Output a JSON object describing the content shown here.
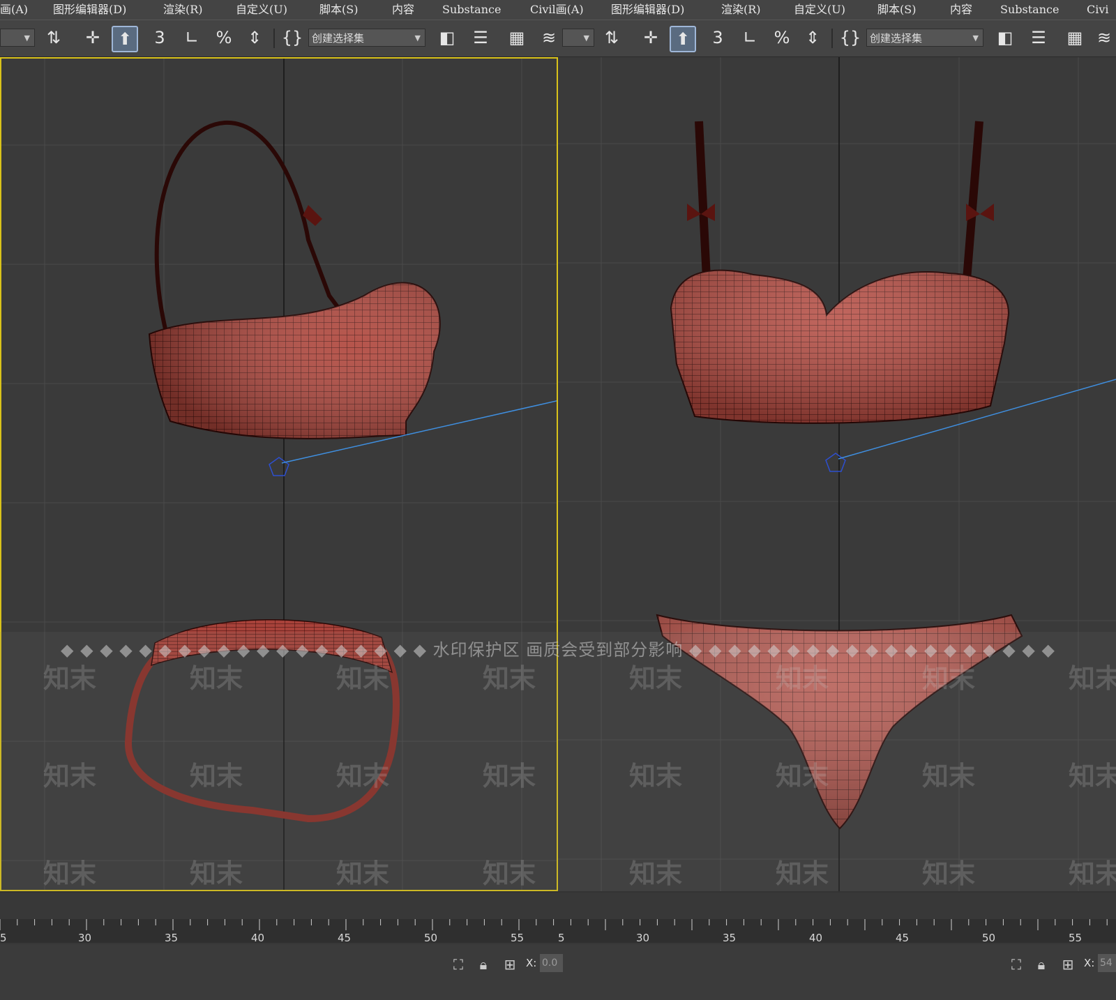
{
  "menu": {
    "left": [
      "画(A)",
      "图形编辑器(D)",
      "渲染(R)",
      "自定义(U)",
      "脚本(S)",
      "内容",
      "Substance",
      "Civil画(A)"
    ],
    "right": [
      "图形编辑器(D)",
      "渲染(R)",
      "自定义(U)",
      "脚本(S)",
      "内容",
      "Substance",
      "Civi"
    ]
  },
  "toolbar": {
    "selection_set_placeholder": "创建选择集",
    "snap_3d_label": "3",
    "angle_snap_label": "∟",
    "percent_snap_label": "%"
  },
  "viewports": {
    "left": {
      "label": "left-viewport",
      "active": true
    },
    "right": {
      "label": "right-viewport",
      "active": false
    }
  },
  "watermark": {
    "banner": "◆ ◆ ◆ ◆ ◆ ◆ ◆ ◆ ◆ ◆ ◆ ◆ ◆ ◆ ◆ ◆ ◆ ◆ ◆ 水印保护区  画质会受到部分影响 ◆ ◆ ◆ ◆ ◆ ◆ ◆ ◆ ◆ ◆ ◆ ◆ ◆ ◆ ◆ ◆ ◆ ◆ ◆",
    "mark": "知末"
  },
  "timeline": {
    "left_ticks": [
      "5",
      "30",
      "35",
      "40",
      "45",
      "50",
      "55"
    ],
    "right_ticks": [
      "5",
      "30",
      "35",
      "40",
      "45",
      "50",
      "55"
    ]
  },
  "status": {
    "left_x_label": "X:",
    "left_x_value": "0.0",
    "right_x_label": "X:",
    "right_x_value": "54"
  },
  "colors": {
    "accent_active_viewport": "#d9c21a",
    "mesh_fill": "#b0463c",
    "mesh_wire": "#3a0f0c",
    "camera_line": "#3f8fe0"
  }
}
